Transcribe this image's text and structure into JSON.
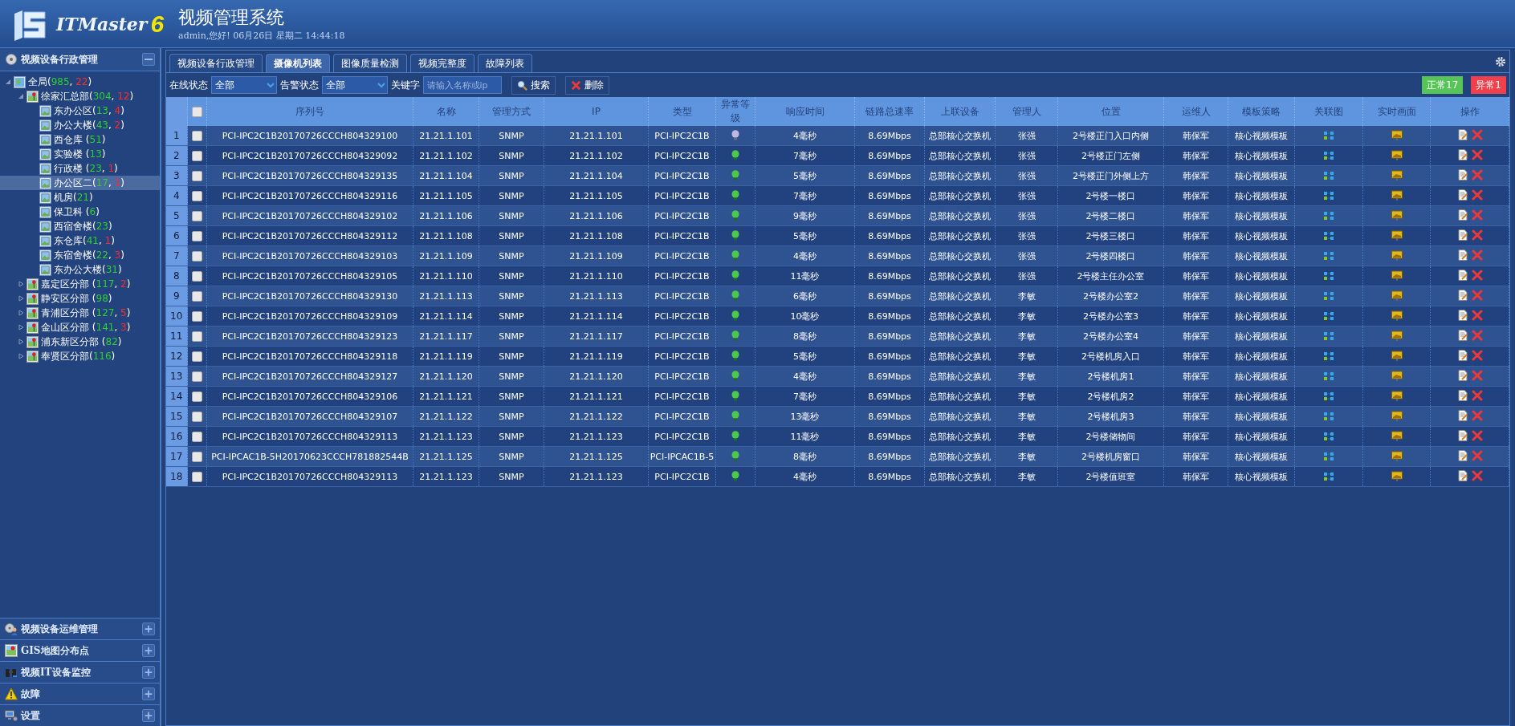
{
  "header": {
    "logo_text": "ITMaster",
    "logo_version": "6",
    "title": "视频管理系统",
    "user_info": "admin,您好! 06月26日 星期二 14:44:18"
  },
  "sidebar": {
    "panel_title": "视频设备行政管理",
    "tree": [
      {
        "label": "全局(985, 22)",
        "kind": "root",
        "expanded": true,
        "selected": false,
        "children": [
          {
            "label": "徐家汇总部(304, 12)",
            "kind": "region",
            "expanded": true,
            "selected": false,
            "children": [
              {
                "label": "东办公区(13, 4)",
                "kind": "building",
                "selected": false
              },
              {
                "label": "办公大楼(43, 2)",
                "kind": "building",
                "selected": false
              },
              {
                "label": "西仓库 (51)",
                "kind": "building",
                "selected": false
              },
              {
                "label": "实验楼 (13)",
                "kind": "building",
                "selected": false
              },
              {
                "label": "行政楼 (23, 1)",
                "kind": "building",
                "selected": false
              },
              {
                "label": "办公区二(17, 1)",
                "kind": "building",
                "selected": true
              },
              {
                "label": "机房(21)",
                "kind": "building",
                "selected": false
              },
              {
                "label": "保卫科 (6)",
                "kind": "building",
                "selected": false
              },
              {
                "label": "西宿舍楼(23)",
                "kind": "building",
                "selected": false
              },
              {
                "label": "东仓库(41, 1)",
                "kind": "building",
                "selected": false
              },
              {
                "label": "东宿舍楼(22, 3)",
                "kind": "building",
                "selected": false
              },
              {
                "label": "东办公大楼(31)",
                "kind": "building",
                "selected": false
              }
            ]
          },
          {
            "label": "嘉定区分部 (117, 2)",
            "kind": "region",
            "expanded": false,
            "selected": false
          },
          {
            "label": "静安区分部 (98)",
            "kind": "region",
            "expanded": false,
            "selected": false
          },
          {
            "label": "青浦区分部 (127, 5)",
            "kind": "region",
            "expanded": false,
            "selected": false
          },
          {
            "label": "金山区分部 (141, 3)",
            "kind": "region",
            "expanded": false,
            "selected": false
          },
          {
            "label": "浦东新区分部 (82)",
            "kind": "region",
            "expanded": false,
            "selected": false
          },
          {
            "label": "奉贤区分部(116)",
            "kind": "region",
            "expanded": false,
            "selected": false
          }
        ]
      }
    ],
    "sections": [
      {
        "label": "视频设备运维管理",
        "kind": "ops"
      },
      {
        "label": "GIS地图分布点",
        "kind": "gis"
      },
      {
        "label": "视频IT设备监控",
        "kind": "monitor"
      },
      {
        "label": "故障",
        "kind": "fault"
      },
      {
        "label": "设置",
        "kind": "settings"
      }
    ]
  },
  "tabs": [
    {
      "label": "视频设备行政管理",
      "selected": false
    },
    {
      "label": "摄像机列表",
      "selected": true
    },
    {
      "label": "图像质量检测",
      "selected": false
    },
    {
      "label": "视频完整度",
      "selected": false
    },
    {
      "label": "故障列表",
      "selected": false
    }
  ],
  "filters": {
    "online_label": "在线状态",
    "online_value": "全部",
    "alarm_label": "告警状态",
    "alarm_value": "全部",
    "keyword_label": "关键字",
    "keyword_placeholder": "请输入名称或ip",
    "search_button": "搜索",
    "delete_button": "删除"
  },
  "status_badges": [
    {
      "label": "正常17",
      "kind": "normal"
    },
    {
      "label": "异常1",
      "kind": "abnormal"
    }
  ],
  "table": {
    "header_checked": false,
    "columns": [
      "序列号",
      "名称",
      "管理方式",
      "IP",
      "类型",
      "异常等级",
      "响应时间",
      "链路总速率",
      "上联设备",
      "管理人",
      "位置",
      "运维人",
      "模板策略",
      "关联图",
      "实时画面",
      "操作"
    ],
    "rows": [
      {
        "no": "1",
        "checked": false,
        "serial": "PCI-IPC2C1B20170726CCCH804329100",
        "name": "21.21.1.101",
        "mgmt": "SNMP",
        "ip": "21.21.1.101",
        "type": "PCI-IPC2C1B",
        "abnormal": true,
        "response": "4毫秒",
        "speed": "8.69Mbps",
        "uplink": "总部核心交换机",
        "manager": "张强",
        "location": "2号楼正门入口内侧",
        "operator": "韩保军",
        "template": "核心视频模板"
      },
      {
        "no": "2",
        "checked": false,
        "serial": "PCI-IPC2C1B20170726CCCH804329092",
        "name": "21.21.1.102",
        "mgmt": "SNMP",
        "ip": "21.21.1.102",
        "type": "PCI-IPC2C1B",
        "abnormal": false,
        "response": "7毫秒",
        "speed": "8.69Mbps",
        "uplink": "总部核心交换机",
        "manager": "张强",
        "location": "2号楼正门左侧",
        "operator": "韩保军",
        "template": "核心视频模板"
      },
      {
        "no": "3",
        "checked": false,
        "serial": "PCI-IPC2C1B20170726CCCH804329135",
        "name": "21.21.1.104",
        "mgmt": "SNMP",
        "ip": "21.21.1.104",
        "type": "PCI-IPC2C1B",
        "abnormal": false,
        "response": "5毫秒",
        "speed": "8.69Mbps",
        "uplink": "总部核心交换机",
        "manager": "张强",
        "location": "2号楼正门外侧上方",
        "operator": "韩保军",
        "template": "核心视频模板"
      },
      {
        "no": "4",
        "checked": false,
        "serial": "PCI-IPC2C1B20170726CCCH804329116",
        "name": "21.21.1.105",
        "mgmt": "SNMP",
        "ip": "21.21.1.105",
        "type": "PCI-IPC2C1B",
        "abnormal": false,
        "response": "7毫秒",
        "speed": "8.69Mbps",
        "uplink": "总部核心交换机",
        "manager": "张强",
        "location": "2号楼一楼口",
        "operator": "韩保军",
        "template": "核心视频模板"
      },
      {
        "no": "5",
        "checked": false,
        "serial": "PCI-IPC2C1B20170726CCCH804329102",
        "name": "21.21.1.106",
        "mgmt": "SNMP",
        "ip": "21.21.1.106",
        "type": "PCI-IPC2C1B",
        "abnormal": false,
        "response": "9毫秒",
        "speed": "8.69Mbps",
        "uplink": "总部核心交换机",
        "manager": "张强",
        "location": "2号楼二楼口",
        "operator": "韩保军",
        "template": "核心视频模板"
      },
      {
        "no": "6",
        "checked": false,
        "serial": "PCI-IPC2C1B20170726CCCH804329112",
        "name": "21.21.1.108",
        "mgmt": "SNMP",
        "ip": "21.21.1.108",
        "type": "PCI-IPC2C1B",
        "abnormal": false,
        "response": "5毫秒",
        "speed": "8.69Mbps",
        "uplink": "总部核心交换机",
        "manager": "张强",
        "location": "2号楼三楼口",
        "operator": "韩保军",
        "template": "核心视频模板"
      },
      {
        "no": "7",
        "checked": false,
        "serial": "PCI-IPC2C1B20170726CCCH804329103",
        "name": "21.21.1.109",
        "mgmt": "SNMP",
        "ip": "21.21.1.109",
        "type": "PCI-IPC2C1B",
        "abnormal": false,
        "response": "4毫秒",
        "speed": "8.69Mbps",
        "uplink": "总部核心交换机",
        "manager": "张强",
        "location": "2号楼四楼口",
        "operator": "韩保军",
        "template": "核心视频模板"
      },
      {
        "no": "8",
        "checked": false,
        "serial": "PCI-IPC2C1B20170726CCCH804329105",
        "name": "21.21.1.110",
        "mgmt": "SNMP",
        "ip": "21.21.1.110",
        "type": "PCI-IPC2C1B",
        "abnormal": false,
        "response": "11毫秒",
        "speed": "8.69Mbps",
        "uplink": "总部核心交换机",
        "manager": "张强",
        "location": "2号楼主任办公室",
        "operator": "韩保军",
        "template": "核心视频模板"
      },
      {
        "no": "9",
        "checked": false,
        "serial": "PCI-IPC2C1B20170726CCCH804329130",
        "name": "21.21.1.113",
        "mgmt": "SNMP",
        "ip": "21.21.1.113",
        "type": "PCI-IPC2C1B",
        "abnormal": false,
        "response": "6毫秒",
        "speed": "8.69Mbps",
        "uplink": "总部核心交换机",
        "manager": "李敏",
        "location": "2号楼办公室2",
        "operator": "韩保军",
        "template": "核心视频模板"
      },
      {
        "no": "10",
        "checked": false,
        "serial": "PCI-IPC2C1B20170726CCCH804329109",
        "name": "21.21.1.114",
        "mgmt": "SNMP",
        "ip": "21.21.1.114",
        "type": "PCI-IPC2C1B",
        "abnormal": false,
        "response": "10毫秒",
        "speed": "8.69Mbps",
        "uplink": "总部核心交换机",
        "manager": "李敏",
        "location": "2号楼办公室3",
        "operator": "韩保军",
        "template": "核心视频模板"
      },
      {
        "no": "11",
        "checked": false,
        "serial": "PCI-IPC2C1B20170726CCCH804329123",
        "name": "21.21.1.117",
        "mgmt": "SNMP",
        "ip": "21.21.1.117",
        "type": "PCI-IPC2C1B",
        "abnormal": false,
        "response": "8毫秒",
        "speed": "8.69Mbps",
        "uplink": "总部核心交换机",
        "manager": "李敏",
        "location": "2号楼办公室4",
        "operator": "韩保军",
        "template": "核心视频模板"
      },
      {
        "no": "12",
        "checked": false,
        "serial": "PCI-IPC2C1B20170726CCCH804329118",
        "name": "21.21.1.119",
        "mgmt": "SNMP",
        "ip": "21.21.1.119",
        "type": "PCI-IPC2C1B",
        "abnormal": false,
        "response": "5毫秒",
        "speed": "8.69Mbps",
        "uplink": "总部核心交换机",
        "manager": "李敏",
        "location": "2号楼机房入口",
        "operator": "韩保军",
        "template": "核心视频模板"
      },
      {
        "no": "13",
        "checked": false,
        "serial": "PCI-IPC2C1B20170726CCCH804329127",
        "name": "21.21.1.120",
        "mgmt": "SNMP",
        "ip": "21.21.1.120",
        "type": "PCI-IPC2C1B",
        "abnormal": false,
        "response": "4毫秒",
        "speed": "8.69Mbps",
        "uplink": "总部核心交换机",
        "manager": "李敏",
        "location": "2号楼机房1",
        "operator": "韩保军",
        "template": "核心视频模板"
      },
      {
        "no": "14",
        "checked": false,
        "serial": "PCI-IPC2C1B20170726CCCH804329106",
        "name": "21.21.1.121",
        "mgmt": "SNMP",
        "ip": "21.21.1.121",
        "type": "PCI-IPC2C1B",
        "abnormal": false,
        "response": "7毫秒",
        "speed": "8.69Mbps",
        "uplink": "总部核心交换机",
        "manager": "李敏",
        "location": "2号楼机房2",
        "operator": "韩保军",
        "template": "核心视频模板"
      },
      {
        "no": "15",
        "checked": false,
        "serial": "PCI-IPC2C1B20170726CCCH804329107",
        "name": "21.21.1.122",
        "mgmt": "SNMP",
        "ip": "21.21.1.122",
        "type": "PCI-IPC2C1B",
        "abnormal": false,
        "response": "13毫秒",
        "speed": "8.69Mbps",
        "uplink": "总部核心交换机",
        "manager": "李敏",
        "location": "2号楼机房3",
        "operator": "韩保军",
        "template": "核心视频模板"
      },
      {
        "no": "16",
        "checked": false,
        "serial": "PCI-IPC2C1B20170726CCCH804329113",
        "name": "21.21.1.123",
        "mgmt": "SNMP",
        "ip": "21.21.1.123",
        "type": "PCI-IPC2C1B",
        "abnormal": false,
        "response": "11毫秒",
        "speed": "8.69Mbps",
        "uplink": "总部核心交换机",
        "manager": "李敏",
        "location": "2号楼储物间",
        "operator": "韩保军",
        "template": "核心视频模板"
      },
      {
        "no": "17",
        "checked": false,
        "serial": "PCI-IPCAC1B-5H20170623CCCH781882544B",
        "name": "21.21.1.125",
        "mgmt": "SNMP",
        "ip": "21.21.1.125",
        "type": "PCI-IPCAC1B-5",
        "abnormal": false,
        "response": "8毫秒",
        "speed": "8.69Mbps",
        "uplink": "总部核心交换机",
        "manager": "李敏",
        "location": "2号楼机房窗口",
        "operator": "韩保军",
        "template": "核心视频模板"
      },
      {
        "no": "18",
        "checked": false,
        "serial": "PCI-IPC2C1B20170726CCCH804329113",
        "name": "21.21.1.123",
        "mgmt": "SNMP",
        "ip": "21.21.1.123",
        "type": "PCI-IPC2C1B",
        "abnormal": false,
        "response": "4毫秒",
        "speed": "8.69Mbps",
        "uplink": "总部核心交换机",
        "manager": "李敏",
        "location": "2号楼值班室",
        "operator": "韩保军",
        "template": "核心视频模板"
      }
    ]
  }
}
